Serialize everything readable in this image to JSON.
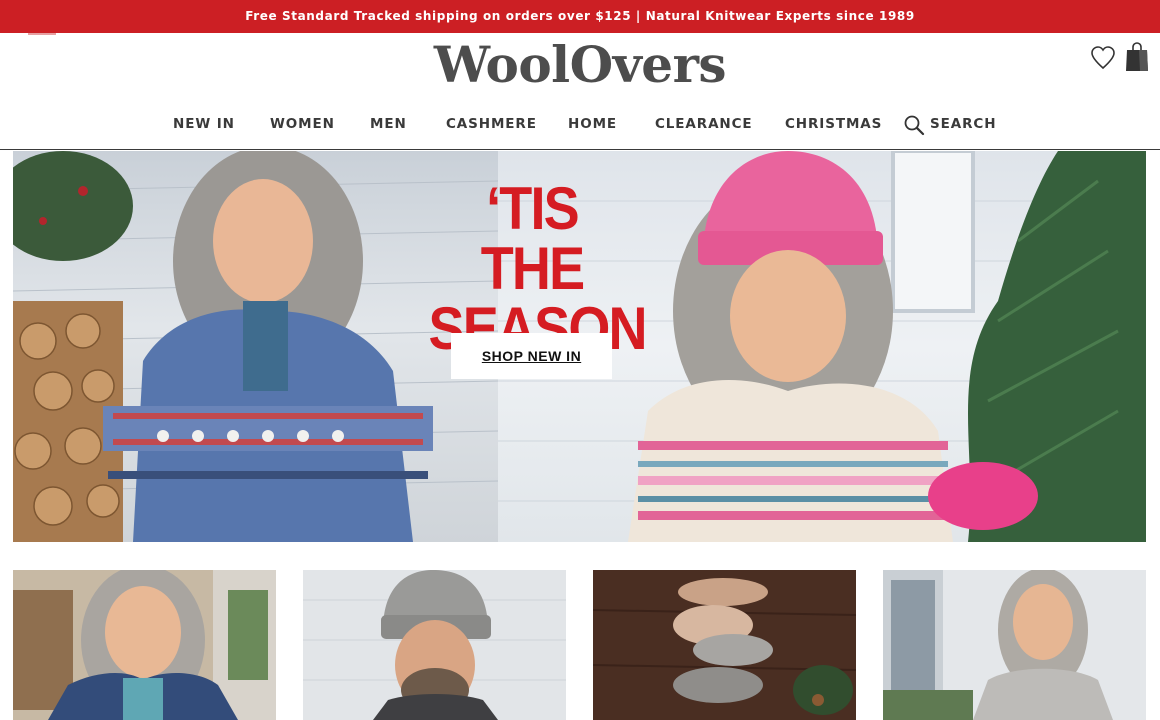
{
  "promo_banner": {
    "text": "Free Standard Tracked shipping on orders over $125 | Natural Knitwear Experts since 1989"
  },
  "header": {
    "logo": "WoolOvers",
    "icons": {
      "wishlist": "heart-icon",
      "bag": "shopping-bag-icon",
      "menu": "menu-icon"
    }
  },
  "nav": {
    "items": [
      {
        "label": "NEW IN"
      },
      {
        "label": "WOMEN"
      },
      {
        "label": "MEN"
      },
      {
        "label": "CASHMERE"
      },
      {
        "label": "HOME"
      },
      {
        "label": "CLEARANCE"
      },
      {
        "label": "CHRISTMAS"
      }
    ],
    "search_label": "SEARCH",
    "search_icon": "search-icon"
  },
  "hero": {
    "headline_line1": "‘TIS THE",
    "headline_line2": "SEASON",
    "cta_label": "SHOP NEW IN"
  },
  "colors": {
    "brand_red": "#cc1f24",
    "headline_red": "#d51c22",
    "logo_grey": "#4d4d4d",
    "nav_text": "#3a3a3a"
  },
  "tiles": [
    {
      "image": "woman-in-fair-isle-vest"
    },
    {
      "image": "man-in-knit-hat"
    },
    {
      "image": "sheepskin-slippers"
    },
    {
      "image": "woman-in-grey-sweater"
    }
  ]
}
